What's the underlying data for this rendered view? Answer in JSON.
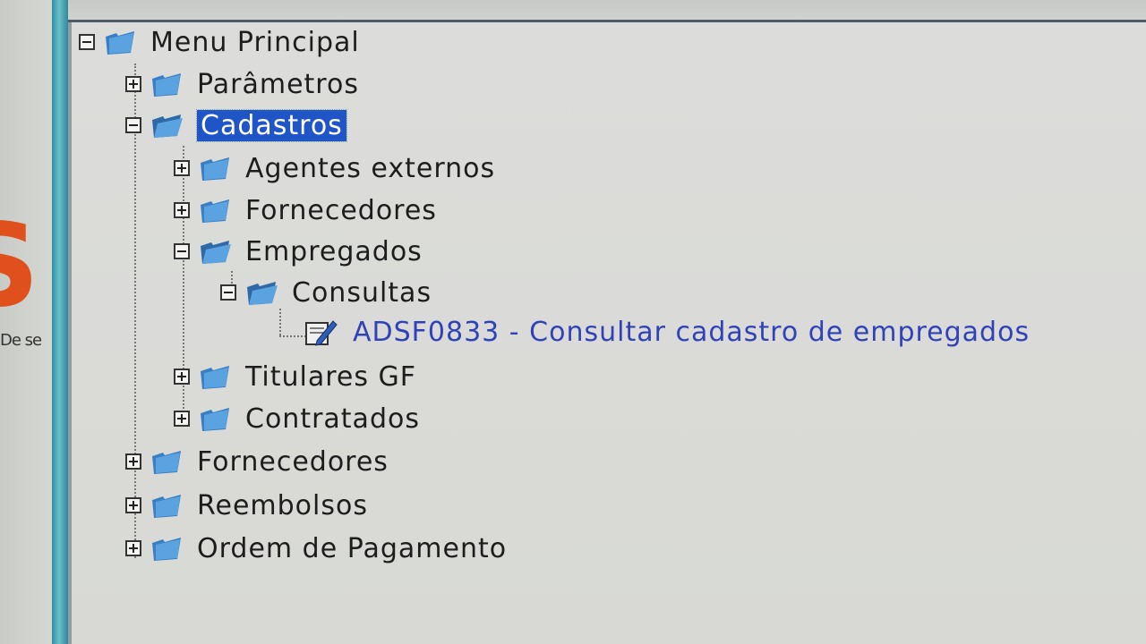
{
  "left_app": {
    "logo_text": "De se"
  },
  "tree": {
    "root": "Menu Principal",
    "items": {
      "parametros": "Parâmetros",
      "cadastros": "Cadastros",
      "agentes_externos": "Agentes externos",
      "fornecedores_sub": "Fornecedores",
      "empregados": "Empregados",
      "consultas": "Consultas",
      "adsf0833": "ADSF0833 - Consultar cadastro de empregados",
      "titulares_gf": "Titulares GF",
      "contratados": "Contratados",
      "fornecedores": "Fornecedores",
      "reembolsos": "Reembolsos",
      "ordem_pagamento": "Ordem de Pagamento"
    },
    "selected": "Cadastros"
  },
  "colors": {
    "selection": "#2055c8",
    "link": "#3142b8",
    "folder": "#3a7fc4",
    "window_frame": "#2d8fa0"
  }
}
